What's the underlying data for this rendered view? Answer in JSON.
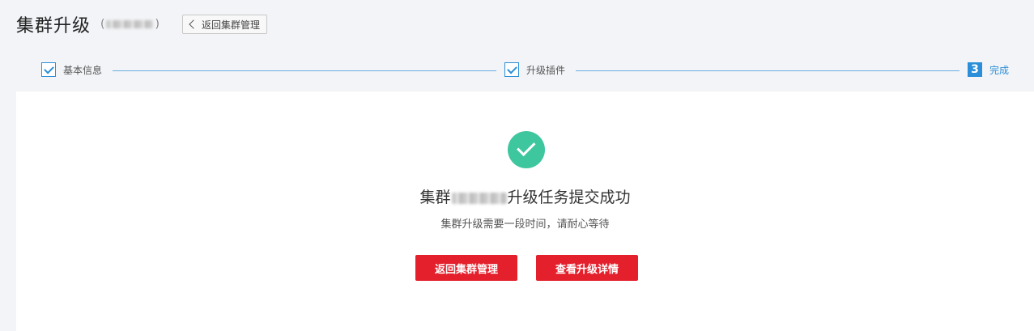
{
  "header": {
    "title": "集群升级",
    "name_open": "(",
    "name_close": ")",
    "back_label": "返回集群管理"
  },
  "steps": [
    {
      "label": "基本信息",
      "state": "done"
    },
    {
      "label": "升级插件",
      "state": "done"
    },
    {
      "label": "完成",
      "number": "3",
      "state": "active"
    }
  ],
  "result": {
    "title_prefix": "集群",
    "title_suffix": "升级任务提交成功",
    "subtitle": "集群升级需要一段时间，请耐心等待",
    "icon": "check-circle-icon"
  },
  "actions": {
    "back_label": "返回集群管理",
    "detail_label": "查看升级详情"
  },
  "colors": {
    "accent": "#2b8ed8",
    "primary_button": "#e3202c",
    "success": "#3ec79e"
  }
}
